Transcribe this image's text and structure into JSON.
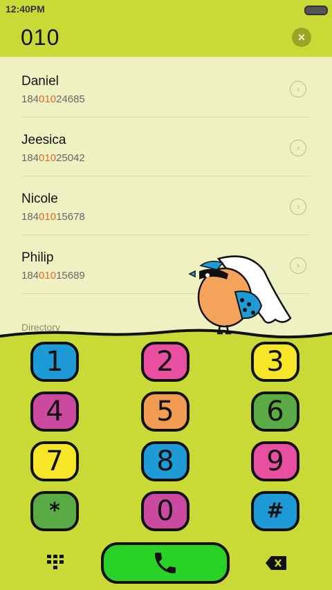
{
  "status": {
    "time": "12:40PM"
  },
  "dialer": {
    "number": "010",
    "clear_icon": "×"
  },
  "contacts": [
    {
      "name": "Daniel",
      "pre": "184",
      "match": "010",
      "post": "24685"
    },
    {
      "name": "Jeesica",
      "pre": "184",
      "match": "010",
      "post": "25042"
    },
    {
      "name": "Nicole",
      "pre": "184",
      "match": "010",
      "post": "15678"
    },
    {
      "name": "Philip",
      "pre": "184",
      "match": "010",
      "post": "15689"
    }
  ],
  "directory_label": "Directory",
  "keys": [
    {
      "label": "1",
      "color": "#1e9ad6"
    },
    {
      "label": "2",
      "color": "#e94fa1"
    },
    {
      "label": "3",
      "color": "#f7e627"
    },
    {
      "label": "4",
      "color": "#c94aa0"
    },
    {
      "label": "5",
      "color": "#f29b52"
    },
    {
      "label": "6",
      "color": "#5aaa45"
    },
    {
      "label": "7",
      "color": "#f7e627"
    },
    {
      "label": "8",
      "color": "#1e9ad6"
    },
    {
      "label": "9",
      "color": "#e94fa1"
    },
    {
      "label": "*",
      "color": "#5aaa45"
    },
    {
      "label": "0",
      "color": "#c94aa0"
    },
    {
      "label": "#",
      "color": "#1e9ad6"
    }
  ],
  "colors": {
    "accent": "#c9d936",
    "highlight": "#e6671d",
    "call": "#2ad126"
  }
}
